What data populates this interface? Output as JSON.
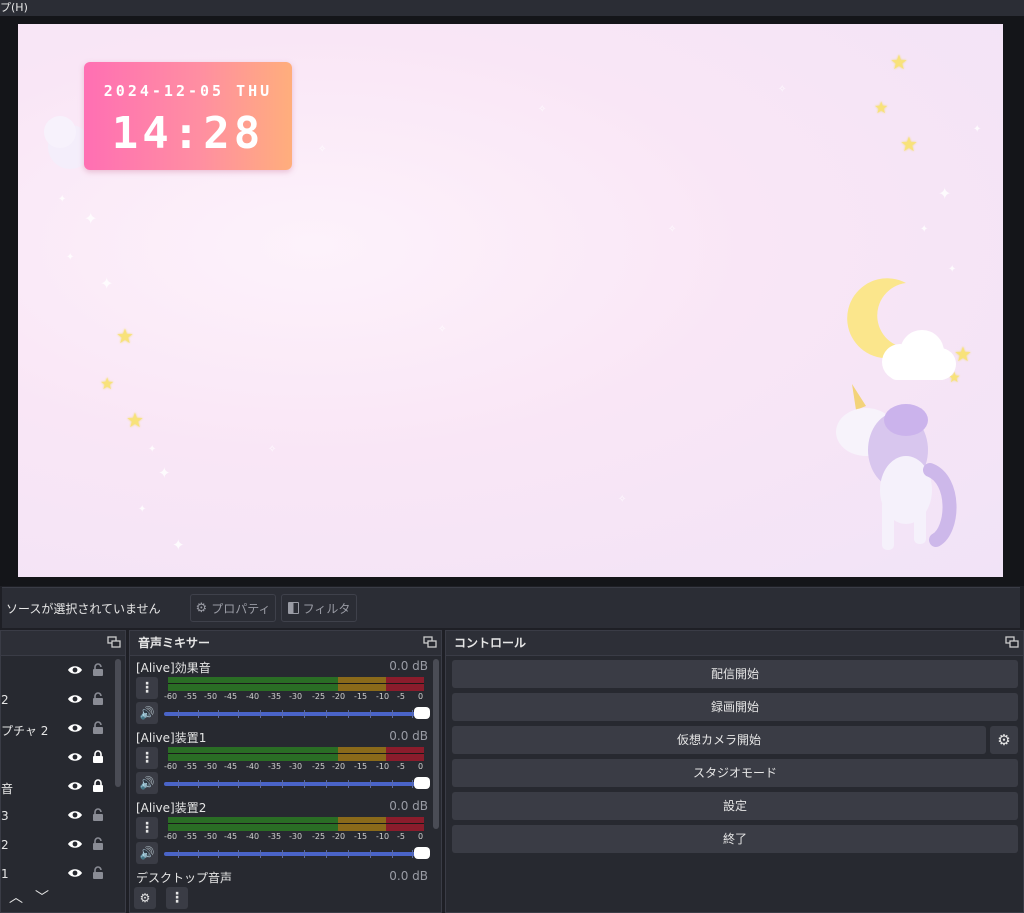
{
  "menubar": {
    "text": "プ(H)"
  },
  "preview": {
    "clock": {
      "date": "2024-12-05 THU",
      "time": "14:28"
    }
  },
  "source_bar": {
    "message": "ソースが選択されていません",
    "properties_label": "プロパティ",
    "filters_label": "フィルタ"
  },
  "sources": {
    "rows": [
      {
        "name": "",
        "locked": false
      },
      {
        "name": "2",
        "locked": false
      },
      {
        "name": "プチャ 2",
        "locked": false
      },
      {
        "name": "",
        "locked": true
      },
      {
        "name": "音",
        "locked": true
      },
      {
        "name": "3",
        "locked": false
      },
      {
        "name": "2",
        "locked": false
      },
      {
        "name": "1",
        "locked": false
      }
    ]
  },
  "mixer": {
    "title": "音声ミキサー",
    "tick_labels": [
      "-60",
      "-55",
      "-50",
      "-45",
      "-40",
      "-35",
      "-30",
      "-25",
      "-20",
      "-15",
      "-10",
      "-5",
      "0"
    ],
    "items": [
      {
        "name": "[Alive]効果音",
        "db": "0.0 dB",
        "volume": 1.0
      },
      {
        "name": "[Alive]装置1",
        "db": "0.0 dB",
        "volume": 1.0
      },
      {
        "name": "[Alive]装置2",
        "db": "0.0 dB",
        "volume": 1.0
      },
      {
        "name": "デスクトップ音声",
        "db": "0.0 dB"
      }
    ]
  },
  "controls": {
    "title": "コントロール",
    "buttons": {
      "start_stream": "配信開始",
      "start_record": "録画開始",
      "start_virtualcam": "仮想カメラ開始",
      "studio_mode": "スタジオモード",
      "settings": "設定",
      "exit": "終了"
    }
  }
}
